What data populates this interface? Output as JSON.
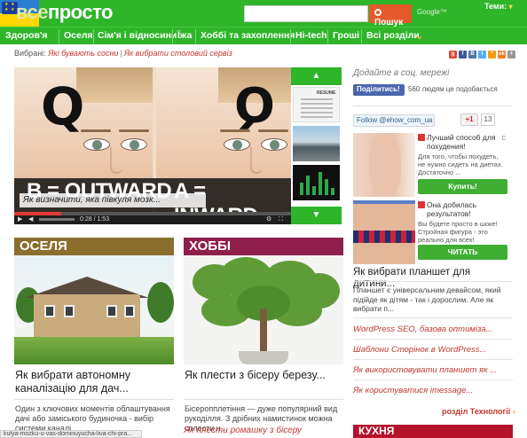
{
  "header": {
    "logo_prefix": "все",
    "logo_main": "просто",
    "search_placeholder": "",
    "search_button": "Пошук",
    "google_label": "Google™",
    "theme_label": "Теми:",
    "theme_chevron": "▾"
  },
  "nav": {
    "items": [
      "Здоров'я",
      "Оселя",
      "Сім'я і відносини",
      "Їжа",
      "Хоббі та захоплення",
      "Hi-tech",
      "Гроші",
      "Всі розділи"
    ],
    "more_chevron": "⌄"
  },
  "breadcrumb": {
    "label": "Вибрані:",
    "links": [
      "Які бувають сосни",
      "Як вибрати столовий сервіз"
    ]
  },
  "hero": {
    "letter_left": "Q",
    "letter_right": "Q",
    "bottom_left": "B = OUTWARD",
    "bottom_right": "A = INWARD",
    "caption": "Як визначити, яка півкуля мозк...",
    "time": "0:28 / 1:53",
    "progress": 0.17
  },
  "thumbs": {
    "up_arrow": "▲",
    "down_arrow": "▼",
    "resume_label": "RESUME"
  },
  "cards": [
    {
      "banner": "ОСЕЛЯ",
      "color": "#8b6f2f",
      "title": "Як вибрати автономну каналізацію для дач...",
      "desc": "Один з ключових моментів облаштування дачі або заміського будиночка - вибір системи каналі..."
    },
    {
      "banner": "ХОББІ",
      "color": "#8e1f4a",
      "title": "Як плести з бісеру березу...",
      "desc": "Бісеропплетіння — дуже популярний вид рукоділля. З дрібних намистинок можна сплести н..."
    }
  ],
  "bottom_link": "Як плести ромашку з бісеру",
  "status_text": "kulya-mozku-u-vas-dominuyucha-liva-chi-pra...",
  "right": {
    "social_heading": "Додайте в соц. мережі",
    "social_icons": [
      {
        "name": "g",
        "color": "#dd4b39"
      },
      {
        "name": "f",
        "color": "#3b5998"
      },
      {
        "name": "В",
        "color": "#4c75a3"
      },
      {
        "name": "t",
        "color": "#55acee"
      },
      {
        "name": "*",
        "color": "#f39c12"
      },
      {
        "name": "ok",
        "color": "#ed812b"
      },
      {
        "name": "+",
        "color": "#999999"
      }
    ],
    "fb_button": "Поділитись!",
    "fb_count": "560 людям це подобається",
    "tw_button": "Follow @ehow_com_ua",
    "gplus_label": "+1",
    "gplus_count": "13",
    "ads": [
      {
        "headline": "Лучший способ для похудения!",
        "text": "Для того, чтобы похудеть, не нужно сидеть на диетах. Достаточно ...",
        "cta": "Купить!"
      },
      {
        "headline": "Она добилась результатов!",
        "text": "Вы будете просто в шоке! Стройная фигура - это реально для всех!",
        "cta": "ЧИТАТЬ"
      }
    ],
    "article_title": "Як вибрати планшет для дитини...",
    "article_desc": "Планшет є універсальним девайсом, який підійде як дітям - так і дорослим. Але як вибрати п...",
    "links": [
      "WordPress SEO, базова оптимізa...",
      "Шаблони Сторінок в WordPress...",
      "Як використовувати планшет як ...",
      "Як користуватися imessage..."
    ],
    "more": "розділ Технології",
    "more_arrow": "›",
    "next_section": "КУХНЯ"
  }
}
